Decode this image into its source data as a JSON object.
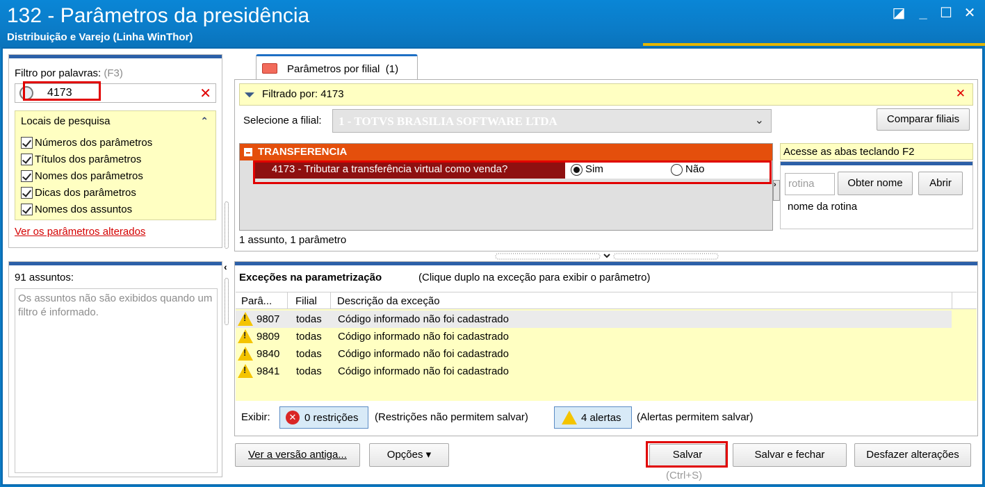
{
  "window": {
    "title": "132 - Parâmetros da presidência",
    "subtitle": "Distribuição e Varejo (Linha WinThor)",
    "controls": {
      "restore": "◪",
      "minimize": "_",
      "maximize": "☐",
      "close": "✕"
    }
  },
  "filter": {
    "label": "Filtro por palavras:",
    "shortcut": "(F3)",
    "value": "4173",
    "clear": "✕",
    "locais_title": "Locais de pesquisa",
    "locais": [
      "Números dos parâmetros",
      "Títulos dos parâmetros",
      "Nomes dos parâmetros",
      "Dicas dos parâmetros",
      "Nomes dos assuntos"
    ],
    "altered_link": "Ver os parâmetros alterados"
  },
  "subjects": {
    "count_label": "91 assuntos:",
    "info": "Os assuntos não são exibidos quando um filtro é informado."
  },
  "tab": {
    "label": "Parâmetros por filial",
    "count": "(1)"
  },
  "main": {
    "filtered_by": "Filtrado por: 4173",
    "filial_label": "Selecione a filial:",
    "filial_value": "1 - TOTVS BRASILIA SOFTWARE LTDA",
    "compare_button": "Comparar filiais",
    "group_title": "TRANSFERENCIA",
    "param_name": "4173 - Tributar a transferência virtual como venda?",
    "option_yes": "Sim",
    "option_no": "Não",
    "selected": "Sim",
    "hint": "Acesse as abas teclando F2",
    "rotina_placeholder": "rotina",
    "get_name_button": "Obter nome",
    "open_button": "Abrir",
    "rotina_name": "nome da rotina",
    "count_text": "1 assunto, 1 parâmetro"
  },
  "exceptions": {
    "title": "Exceções na parametrização",
    "subtitle": "(Clique duplo na exceção para exibir o parâmetro)",
    "columns": [
      "Parâ...",
      "Filial",
      "Descrição da exceção"
    ],
    "rows": [
      {
        "param": "9807",
        "filial": "todas",
        "desc": "Código informado não foi cadastrado"
      },
      {
        "param": "9809",
        "filial": "todas",
        "desc": "Código informado não foi cadastrado"
      },
      {
        "param": "9840",
        "filial": "todas",
        "desc": "Código informado não foi cadastrado"
      },
      {
        "param": "9841",
        "filial": "todas",
        "desc": "Código informado não foi cadastrado"
      }
    ],
    "exibir": "Exibir:",
    "restrictions": "0 restrições",
    "restrictions_note": "(Restrições não permitem salvar)",
    "alerts": "4 alertas",
    "alerts_note": "(Alertas permitem salvar)"
  },
  "footer": {
    "old_version": "Ver a versão antiga...",
    "options": "Opções ▾",
    "save": "Salvar",
    "save_close": "Salvar e fechar",
    "undo": "Desfazer alterações",
    "shortcut": "(Ctrl+S)"
  },
  "colors": {
    "titlebar": "#0b7cc8",
    "highlight": "#e10000",
    "group_header": "#e44f0c",
    "selected_row": "#8e1010",
    "yellow_panel": "#ffffc2"
  }
}
